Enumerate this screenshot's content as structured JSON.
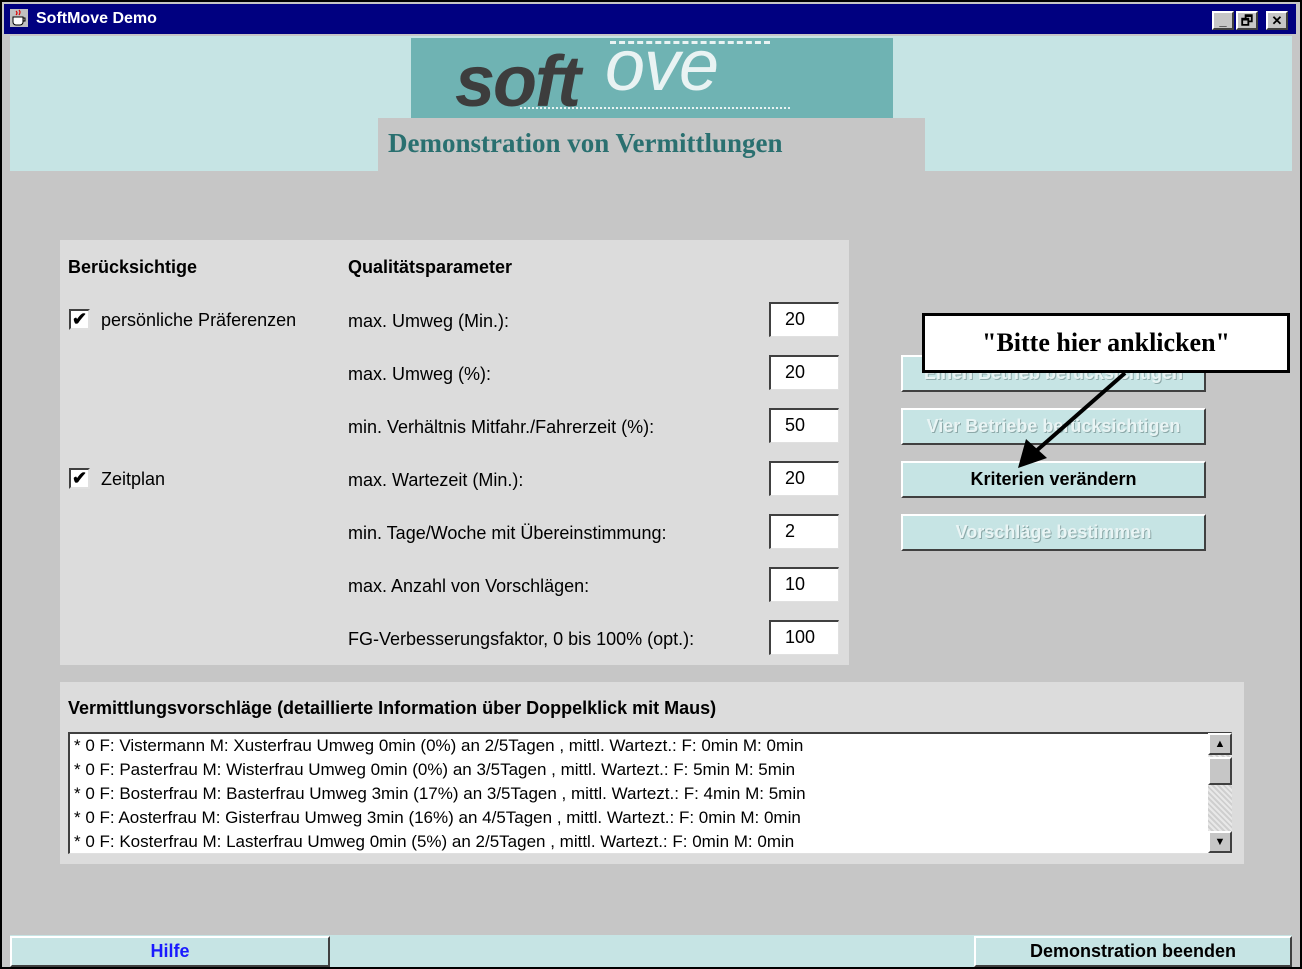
{
  "window": {
    "title": "SoftMove Demo",
    "min_label": "_",
    "max_label": "🗗",
    "close_label": "✕"
  },
  "logo": {
    "text_soft": "soft",
    "text_move": "ove"
  },
  "subtitle": "Demonstration von Vermittlungen",
  "criteria": {
    "header_left": "Berücksichtige",
    "header_right": "Qualitätsparameter",
    "checkboxes": [
      {
        "label": "persönliche Präferenzen",
        "checked": true,
        "mark": "✔"
      },
      {
        "label": "Zeitplan",
        "checked": true,
        "mark": "✔"
      }
    ],
    "params": [
      {
        "label": "max. Umweg (Min.):",
        "value": "20"
      },
      {
        "label": "max. Umweg (%):",
        "value": "20"
      },
      {
        "label": "min. Verhältnis Mitfahr./Fahrerzeit (%):",
        "value": "50"
      },
      {
        "label": "max. Wartezeit (Min.):",
        "value": "20"
      },
      {
        "label": "min. Tage/Woche mit Übereinstimmung:",
        "value": "2"
      },
      {
        "label": "max. Anzahl von Vorschlägen:",
        "value": "10"
      },
      {
        "label": "FG-Verbesserungsfaktor, 0 bis 100% (opt.):",
        "value": "100"
      }
    ]
  },
  "actions": [
    {
      "label": "Einen Betrieb berücksichtigen",
      "enabled": false
    },
    {
      "label": "Vier  Betriebe berücksichtigen",
      "enabled": false
    },
    {
      "label": "Kriterien verändern",
      "enabled": true
    },
    {
      "label": "Vorschläge bestimmen",
      "enabled": false
    }
  ],
  "callout": "\"Bitte hier anklicken\"",
  "suggestions": {
    "title": "Vermittlungsvorschläge (detaillierte Information über Doppelklick mit Maus)",
    "rows": [
      "* 0 F: Vistermann  M: Xusterfrau  Umweg 0min (0%) an 2/5Tagen , mittl. Wartezt.: F: 0min M: 0min",
      "* 0 F: Pasterfrau  M: Wisterfrau  Umweg 0min (0%) an 3/5Tagen , mittl. Wartezt.: F: 5min M: 5min",
      "* 0 F: Bosterfrau  M: Basterfrau  Umweg 3min (17%) an 3/5Tagen , mittl. Wartezt.: F: 4min M: 5min",
      "* 0 F: Aosterfrau  M: Gisterfrau  Umweg 3min (16%) an 4/5Tagen , mittl. Wartezt.: F: 0min M: 0min",
      "* 0 F: Kosterfrau  M: Lasterfrau  Umweg 0min (5%) an 2/5Tagen , mittl. Wartezt.: F: 0min M: 0min"
    ]
  },
  "footer": {
    "help": "Hilfe",
    "exit": "Demonstration beenden"
  },
  "colors": {
    "title_bar": "#000080",
    "accent_teal": "#c6e4e4",
    "logo_bg": "#6fb3b3",
    "subtitle": "#2a7070",
    "help_text": "#1a1aff"
  }
}
